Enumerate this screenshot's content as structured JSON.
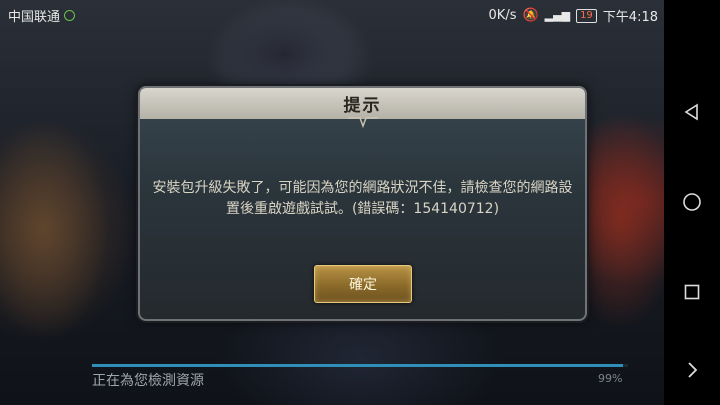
{
  "status_bar": {
    "carrier": "中国联通",
    "speed": "0K/s",
    "battery": "19",
    "time": "下午4:18"
  },
  "dialog": {
    "title": "提示",
    "message": "安裝包升級失敗了，可能因為您的網路狀況不佳，請檢查您的網路設置後重啟遊戲試試。(錯誤碼：154140712)",
    "confirm_label": "確定"
  },
  "loading": {
    "text": "正在為您檢測資源",
    "percent_label": "99%",
    "progress": 0.99
  },
  "nav_bar": {
    "icons": [
      "back-triangle-icon",
      "home-circle-icon",
      "recents-square-icon",
      "expand-chevron-icon"
    ]
  },
  "colors": {
    "progress": "#2f8fb8",
    "button_gold": "#b89245"
  }
}
